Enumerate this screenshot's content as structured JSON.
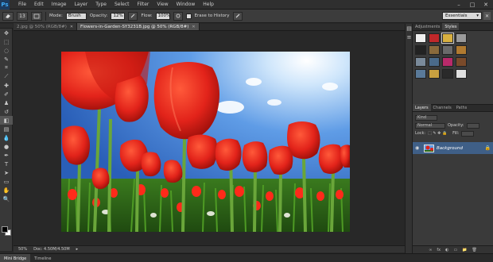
{
  "app": {
    "logo": "Ps"
  },
  "menu": [
    "File",
    "Edit",
    "Image",
    "Layer",
    "Type",
    "Select",
    "Filter",
    "View",
    "Window",
    "Help"
  ],
  "window_controls": {
    "minimize": "–",
    "maximize": "□",
    "close": "✕"
  },
  "options_bar": {
    "brush_size": "13",
    "mode_label": "Mode:",
    "mode_value": "Brush",
    "opacity_label": "Opacity:",
    "opacity_value": "12%",
    "flow_label": "Flow:",
    "flow_value": "100%",
    "erase_history_label": "Erase to History",
    "workspace": "Essentials"
  },
  "doc_tabs": [
    {
      "label": "2.jpg @ 50% (RGB/8#)",
      "active": false
    },
    {
      "label": "Flowers-in-Garden-SY3231B.jpg @ 50% (RGB/8#)",
      "active": true
    }
  ],
  "status": {
    "zoom": "50%",
    "doc_size": "Doc: 4.50M/4.50M"
  },
  "bottom_tabs": [
    {
      "label": "Mini Bridge",
      "active": true
    },
    {
      "label": "Timeline",
      "active": false
    }
  ],
  "adjust_tabs": [
    {
      "label": "Adjustments",
      "active": false
    },
    {
      "label": "Styles",
      "active": true
    }
  ],
  "styles_swatches": [
    "#f0f0f0",
    "#c0282a",
    "#d8b040",
    "#9a9a9a",
    "#222222",
    "#8a6a3c",
    "#6a6a6a",
    "#b07a30",
    "#7a8a9a",
    "#4a6a8a",
    "#b82a6a",
    "#7a4a2a",
    "#5a7a9a",
    "#c8a040",
    "#2a2a2a",
    "#e0e0e0"
  ],
  "layers_tabs": [
    {
      "label": "Layers",
      "active": true
    },
    {
      "label": "Channels",
      "active": false
    },
    {
      "label": "Paths",
      "active": false
    }
  ],
  "layers": {
    "filter_kind": "Kind",
    "blend_mode": "Normal",
    "opacity_label": "Opacity:",
    "lock_label": "Lock:",
    "fill_label": "Fill:",
    "layer_name": "Background",
    "lock_icon": "🔒",
    "footer_icons": [
      "fx",
      "◐",
      "▭",
      "📁",
      "🗑"
    ]
  },
  "colors": {
    "sky": "#3d7fd8",
    "tulip_red": "#e2231a",
    "stem_green": "#5a9a2a",
    "selected_layer": "#3f5f87"
  }
}
